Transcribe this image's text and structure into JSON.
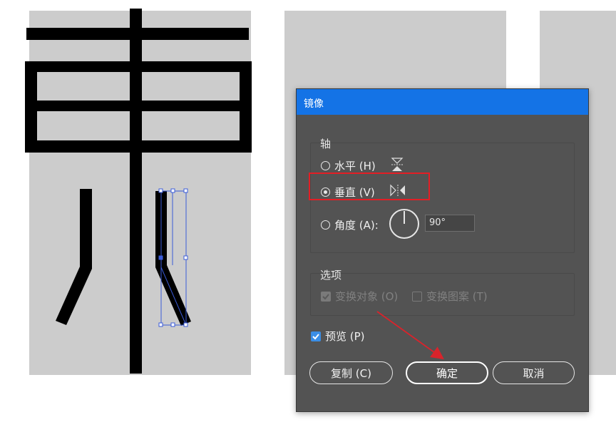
{
  "dialog": {
    "title": "镜像",
    "axis_group": {
      "legend": "轴",
      "horizontal_label": "水平 (H)",
      "vertical_label": "垂直 (V)",
      "angle_label": "角度 (A):",
      "angle_value": "90°",
      "selected": "vertical"
    },
    "options_group": {
      "legend": "选项",
      "transform_objects_label": "变换对象 (O)",
      "transform_objects_checked": true,
      "transform_patterns_label": "变换图案 (T)",
      "transform_patterns_checked": false,
      "enabled": false
    },
    "preview_label": "预览 (P)",
    "preview_checked": true,
    "buttons": {
      "copy": "复制 (C)",
      "ok": "确定",
      "cancel": "取消"
    }
  },
  "colors": {
    "title_bar": "#1473e6",
    "dialog_bg": "#535353",
    "highlight": "#e31e25",
    "annotation_arrow": "#d9232b",
    "selection": "#3a5bd9"
  }
}
